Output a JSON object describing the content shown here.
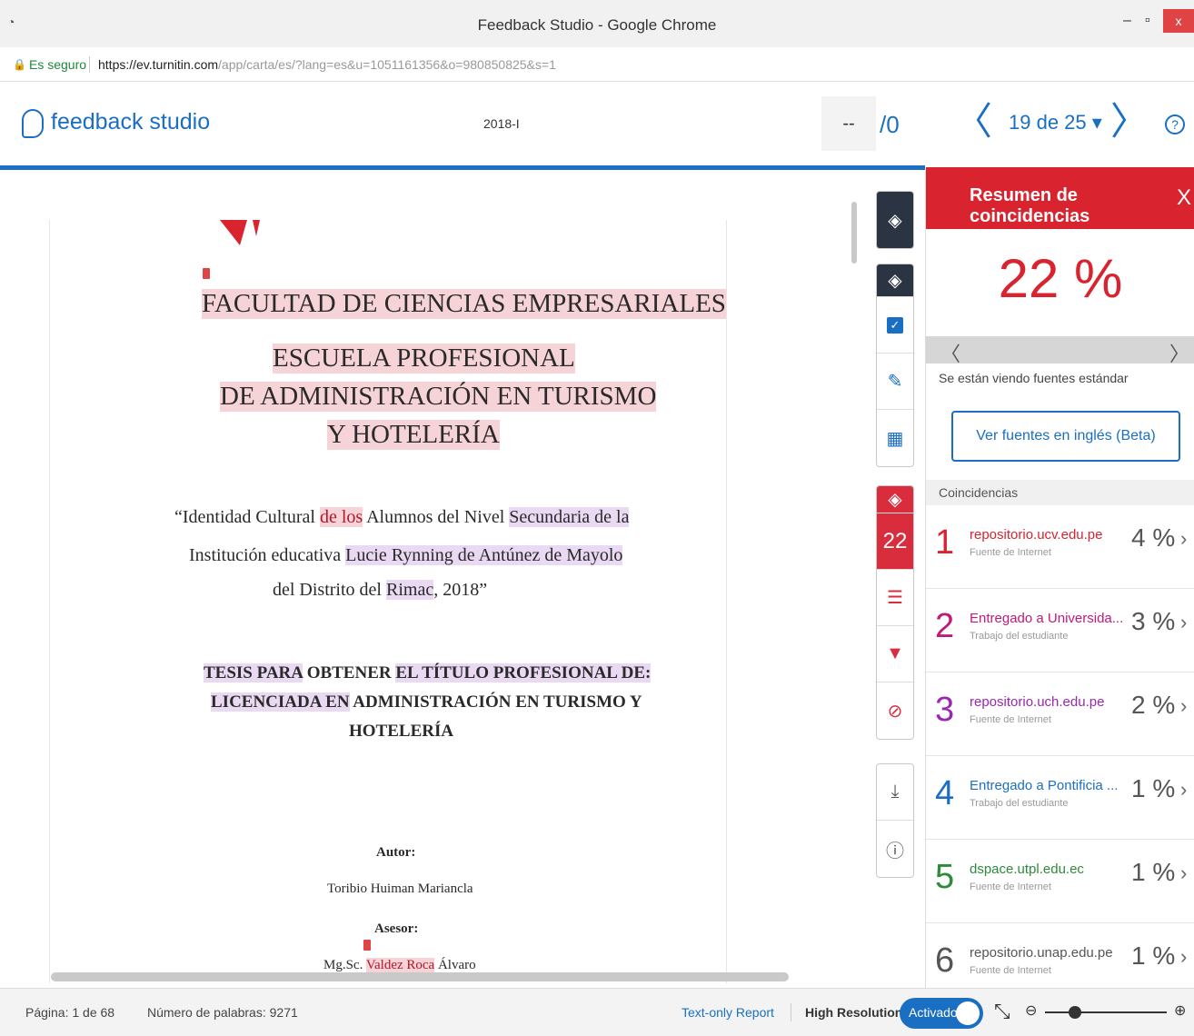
{
  "window": {
    "title": "Feedback Studio - Google Chrome",
    "minimize": "–",
    "restore": "▫",
    "close": "x"
  },
  "address": {
    "secure_label": "Es seguro",
    "url_host": "https://ev.turnitin.com",
    "url_path": "/app/carta/es/?lang=es&u=1051161356&o=980850825&s=1"
  },
  "header": {
    "brand": "feedback studio",
    "assignment": "2018-I",
    "grade": "--",
    "grade_total": "/0",
    "prev": "〈",
    "next": "〉",
    "paper_position": "19 de 25 ▾",
    "help": "?"
  },
  "document": {
    "faculty": "FACULTAD DE CIENCIAS EMPRESARIALES",
    "school_line1": "ESCUELA PROFESIONAL",
    "school_line2": "DE ADMINISTRACIÓN EN TURISMO",
    "school_line3": "Y HOTELERÍA",
    "title_line1_a": "“Identidad Cultural ",
    "title_line1_b": "de los",
    "title_line1_c": " Alumnos del Nivel ",
    "title_line1_d": "Secundaria de la",
    "title_line2_a": "Institución educativa ",
    "title_line2_b": "Lucie Rynning de Antúnez de Mayolo",
    "title_line3_a": "del Distrito del ",
    "title_line3_b": "Rimac",
    "title_line3_c": ", 2018”",
    "thesis_line1_a": "TESIS PARA",
    "thesis_line1_b": " OBTENER ",
    "thesis_line1_c": "EL TÍTULO PROFESIONAL DE:",
    "thesis_line2_a": "LICENCIADA EN",
    "thesis_line2_b": " ADMINISTRACIÓN EN TURISMO Y",
    "thesis_line3": "HOTELERÍA",
    "author_label": "Autor:",
    "author_name": "Toribio Huiman Mariancla",
    "advisor_label": "Asesor:",
    "advisor_a": "Mg.Sc. ",
    "advisor_b": "Valdez Roca",
    "advisor_c": " Álvaro"
  },
  "toolbar": {
    "similarity_score": "22"
  },
  "panel": {
    "title": "Resumen de coincidencias",
    "close": "X",
    "overall": "22 %",
    "prev": "〈",
    "next": "〉",
    "viewing_label": "Se están viendo fuentes estándar",
    "english_button": "Ver fuentes en inglés (Beta)",
    "matches_header": "Coincidencias",
    "matches": [
      {
        "num": "1",
        "source": "repositorio.ucv.edu.pe",
        "type": "Fuente de Internet",
        "pct": "4 %",
        "color": "#d9232f"
      },
      {
        "num": "2",
        "source": "Entregado a Universida...",
        "type": "Trabajo del estudiante",
        "pct": "3 %",
        "color": "#c2187a"
      },
      {
        "num": "3",
        "source": "repositorio.uch.edu.pe",
        "type": "Fuente de Internet",
        "pct": "2 %",
        "color": "#9b27b0"
      },
      {
        "num": "4",
        "source": "Entregado a Pontificia ...",
        "type": "Trabajo del estudiante",
        "pct": "1 %",
        "color": "#1a6fc2"
      },
      {
        "num": "5",
        "source": "dspace.utpl.edu.ec",
        "type": "Fuente de Internet",
        "pct": "1 %",
        "color": "#2e8b3a"
      },
      {
        "num": "6",
        "source": "repositorio.unap.edu.pe",
        "type": "Fuente de Internet",
        "pct": "1 %",
        "color": "#555555"
      }
    ]
  },
  "status": {
    "page": "Página: 1 de 68",
    "words": "Número de palabras: 9271",
    "text_only": "Text-only Report",
    "high_res": "High Resolution",
    "toggle_label": "Activado"
  }
}
